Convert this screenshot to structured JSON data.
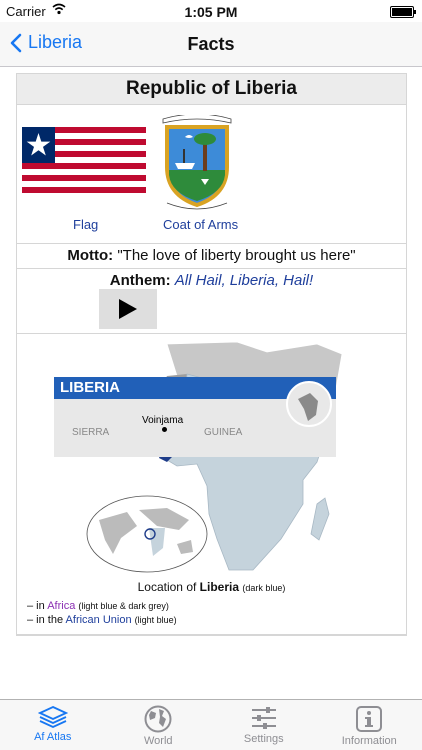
{
  "status": {
    "carrier": "Carrier",
    "time": "1:05 PM"
  },
  "nav": {
    "back_label": "Liberia",
    "title": "Facts"
  },
  "card": {
    "title": "Republic of Liberia",
    "flag_label": "Flag",
    "coa_label": "Coat of Arms",
    "motto_label": "Motto:",
    "motto_text": "\"The love of liberty brought us here\"",
    "anthem_label": "Anthem:",
    "anthem_link": "All Hail, Liberia, Hail!",
    "loc_prefix": "Location of ",
    "loc_country": "Liberia",
    "loc_note": "(dark blue)",
    "legend1_prefix": "– in ",
    "legend1_link": "Africa",
    "legend1_note": "(light blue & dark grey)",
    "legend2_prefix": "– in the ",
    "legend2_link": "African Union",
    "legend2_note": "(light blue)",
    "minimap_title": "LIBERIA",
    "minimap_town": "Voinjama",
    "minimap_left": "SIERRA",
    "minimap_right": "GUINEA"
  },
  "tabs": [
    {
      "label": "Af Atlas",
      "icon": "layers-icon",
      "active": true
    },
    {
      "label": "World",
      "icon": "globe-icon",
      "active": false
    },
    {
      "label": "Settings",
      "icon": "sliders-icon",
      "active": false
    },
    {
      "label": "Information",
      "icon": "info-icon",
      "active": false
    }
  ],
  "colors": {
    "accent": "#1777f2",
    "link": "#1f3f9c",
    "africa": "#c5d3dc",
    "liberia": "#1f3d8a"
  }
}
